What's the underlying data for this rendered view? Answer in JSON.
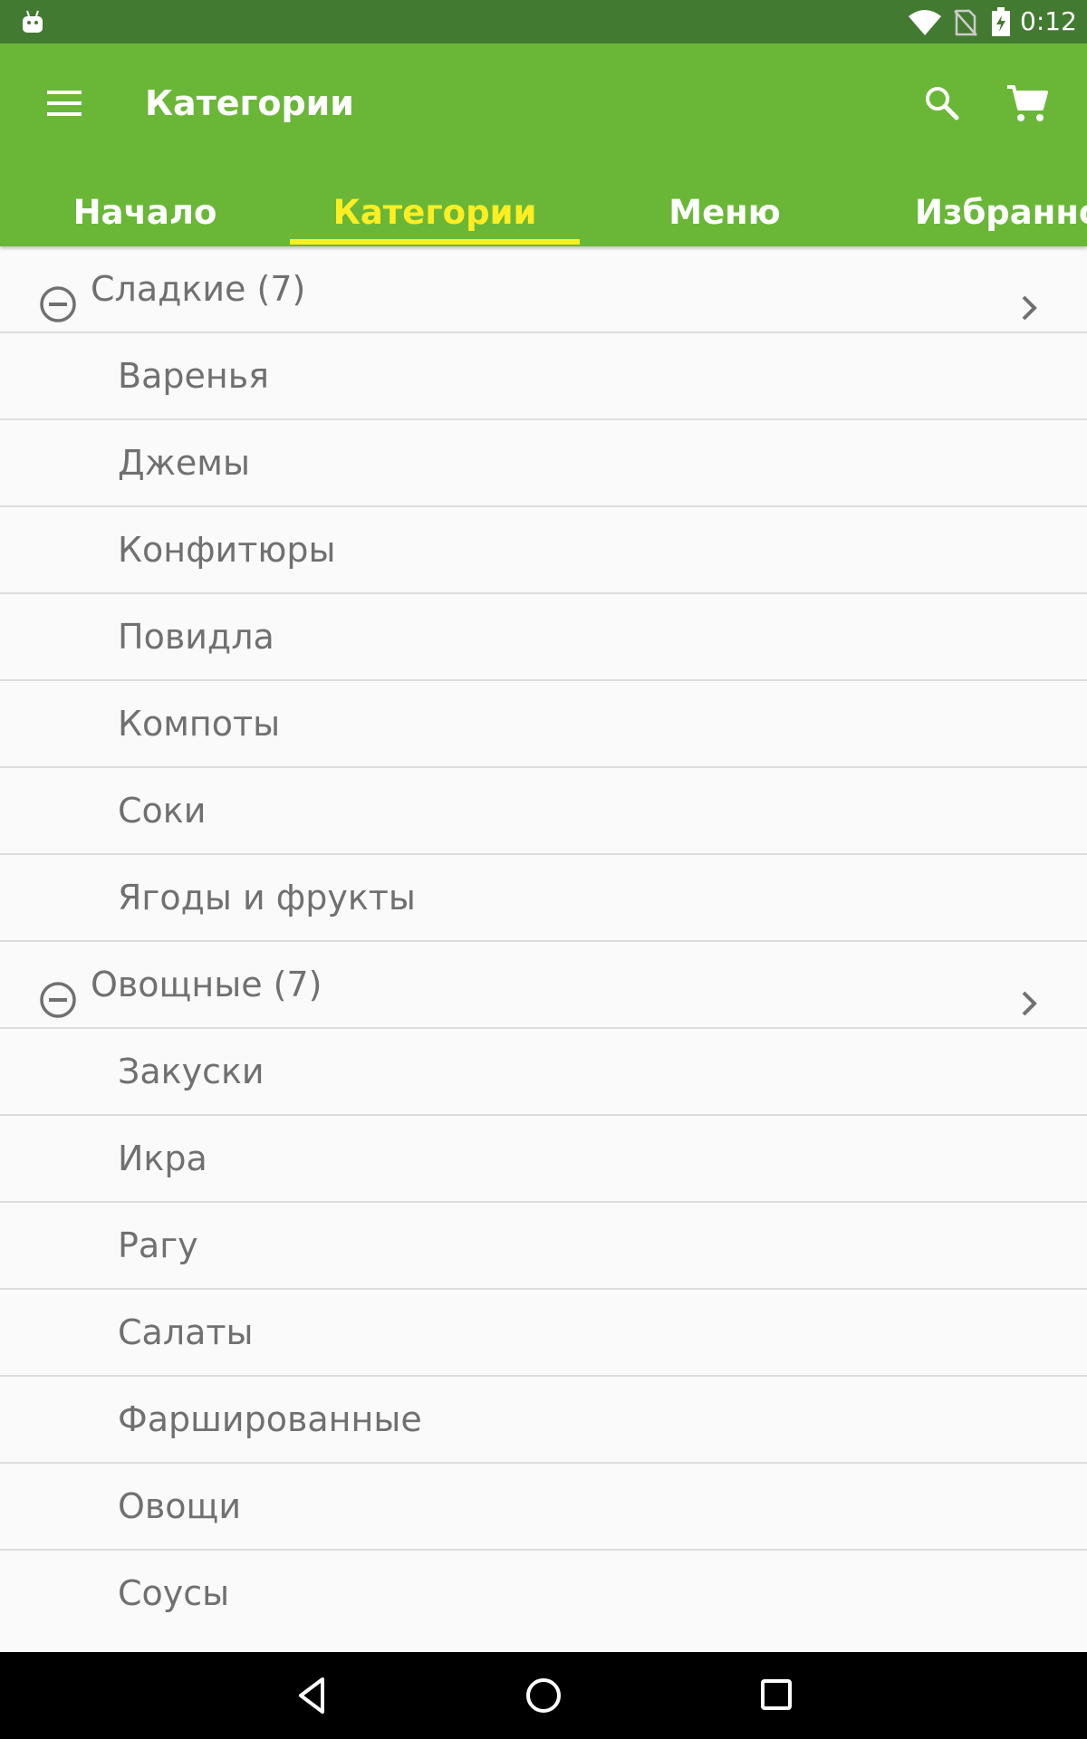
{
  "status_bar": {
    "time": "0:12"
  },
  "app_bar": {
    "title": "Категории"
  },
  "tabs": [
    {
      "label": "Начало"
    },
    {
      "label": "Категории"
    },
    {
      "label": "Меню"
    },
    {
      "label": "Избранно"
    }
  ],
  "active_tab": "Категории",
  "groups": [
    {
      "label": "Сладкие (7)",
      "items": [
        "Варенья",
        "Джемы",
        "Конфитюры",
        "Повидла",
        "Компоты",
        "Соки",
        "Ягоды и фрукты"
      ]
    },
    {
      "label": "Овощные (7)",
      "items": [
        "Закуски",
        "Икра",
        "Рагу",
        "Салаты",
        "Фаршированные",
        "Овощи",
        "Соусы"
      ]
    }
  ],
  "colors": {
    "status_bar": "#437a31",
    "app_bar": "#6ab738",
    "active_tab": "#ffee22",
    "text": "#707070"
  },
  "icons": {
    "status_bar": [
      "android-icon",
      "wifi-icon",
      "no-sim-icon",
      "battery-charging-icon"
    ],
    "app_bar": [
      "menu-icon",
      "search-icon",
      "cart-icon"
    ],
    "list": [
      "collapse-minus-icon",
      "chevron-right-icon"
    ],
    "nav_bar": [
      "back-icon",
      "home-icon",
      "recents-icon"
    ]
  }
}
